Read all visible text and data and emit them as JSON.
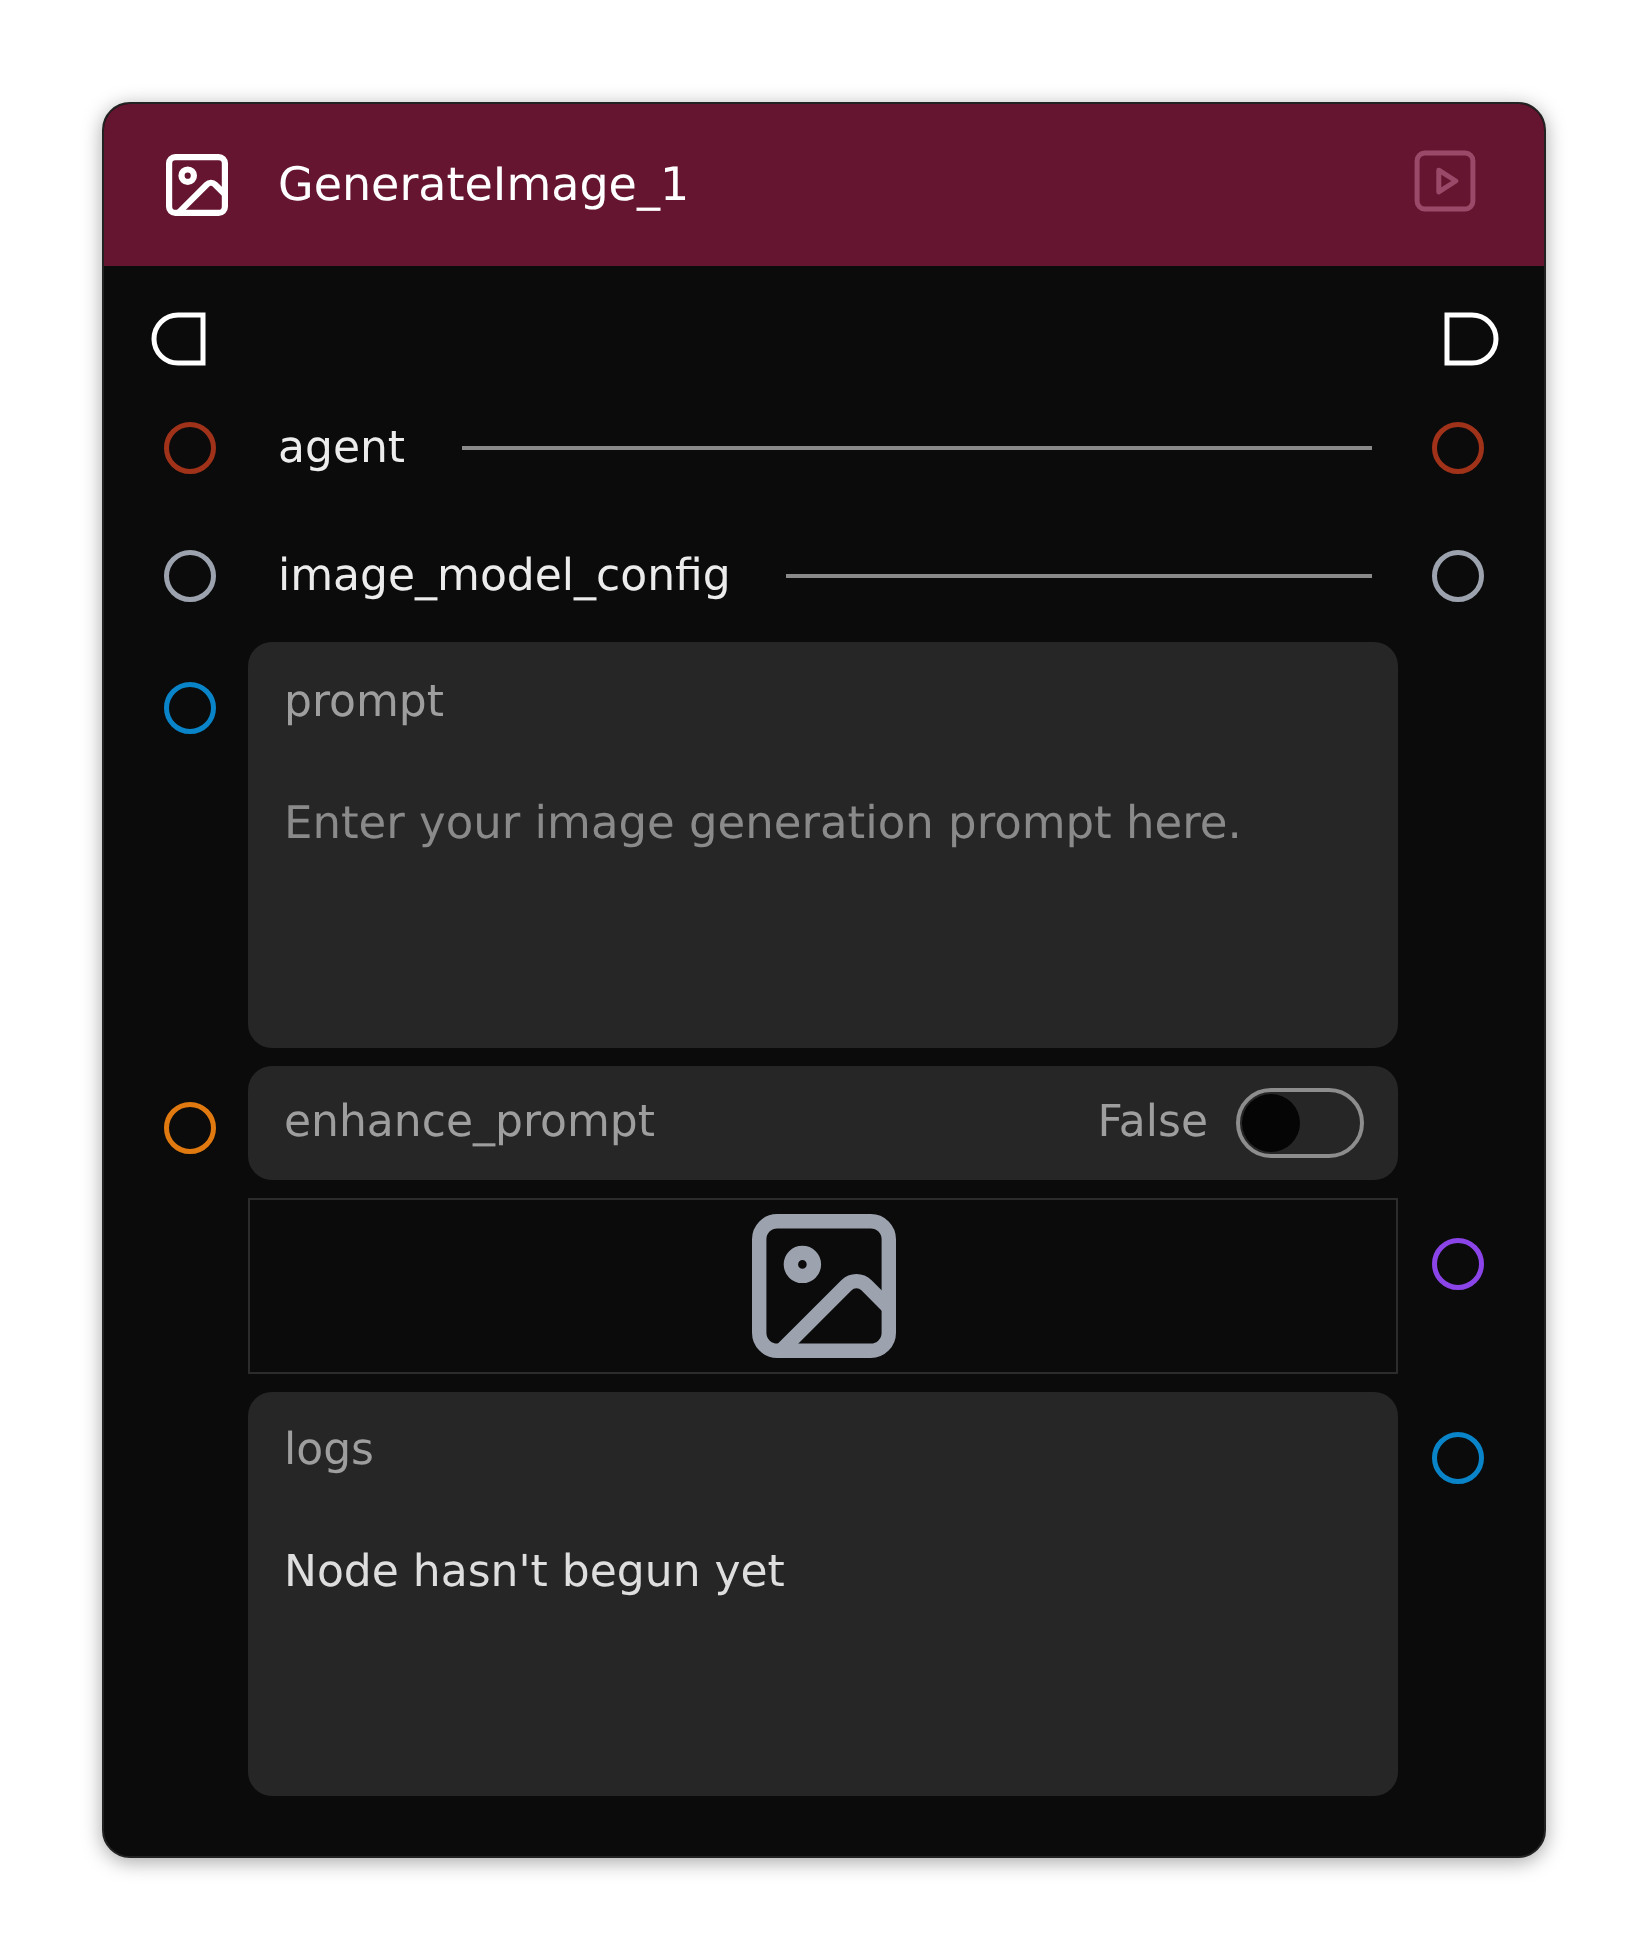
{
  "node": {
    "title": "GenerateImage_1"
  },
  "rows": [
    {
      "kind": "connection",
      "label": "agent",
      "input": {
        "color": "#a0321a"
      },
      "output": {
        "color": "#a0321a"
      }
    },
    {
      "kind": "connection",
      "label": "image_model_config",
      "input": {
        "color": "#9ca3af"
      },
      "output": {
        "color": "#9ca3af"
      }
    },
    {
      "kind": "textarea",
      "label": "prompt",
      "placeholder": "Enter your image generation prompt here.",
      "input": {
        "color": "#0a84c8"
      }
    },
    {
      "kind": "toggle",
      "label": "enhance_prompt",
      "value": "False",
      "on": false,
      "input": {
        "color": "#e07a10"
      }
    },
    {
      "kind": "image",
      "output": {
        "color": "#8b44e8"
      }
    },
    {
      "kind": "logs",
      "label": "logs",
      "text": "Node hasn't begun yet",
      "output": {
        "color": "#0a84c8"
      }
    }
  ]
}
